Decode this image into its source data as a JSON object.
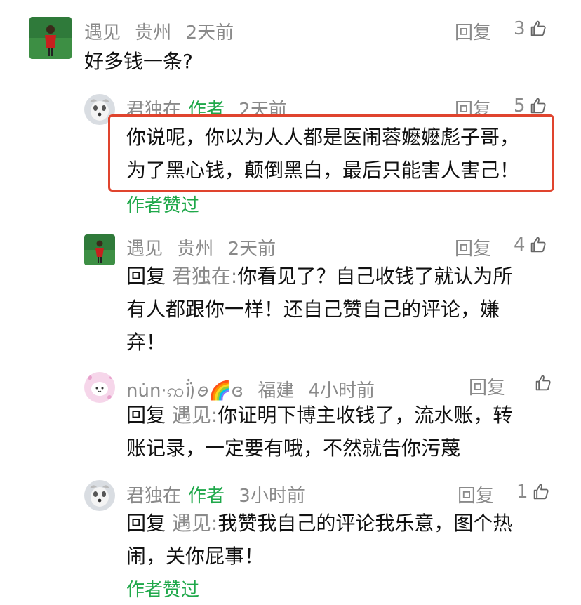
{
  "comments": [
    {
      "user": "遇见",
      "location": "贵州",
      "time": "2天前",
      "reply_label": "回复",
      "likes": "3",
      "text": "好多钱一条?"
    },
    {
      "user": "君独在",
      "author_tag": "作者",
      "time": "2天前",
      "reply_label": "回复",
      "likes": "5",
      "text_line1": "你说呢，你以为人人都是医闹蓉嬷嬷彪子哥，",
      "text_line2": "为了黑心钱，颠倒黑白，最后只能害人害己！",
      "liked_by": "作者赞过"
    },
    {
      "user": "遇见",
      "location": "贵州",
      "time": "2天前",
      "reply_label": "回复",
      "likes": "4",
      "reply_prefix": "回复",
      "reply_to": "君独在:",
      "text_line1": "你看见了？自己收钱了就认为所",
      "text_line2": "有人都跟你一样！还自己赞自己的评论，嫌",
      "text_line3": "弃！"
    },
    {
      "user": "nu̇n·ꩡ꩞ꪮ🌈ɞ",
      "location": "福建",
      "time": "4小时前",
      "reply_label": "回复",
      "likes": "",
      "reply_prefix": "回复",
      "reply_to": "遇见:",
      "text_line1": "你证明下博主收钱了，流水账，转",
      "text_line2": "账记录，一定要有哦，不然就告你污蔑"
    },
    {
      "user": "君独在",
      "author_tag": "作者",
      "time": "3小时前",
      "reply_label": "回复",
      "likes": "1",
      "reply_prefix": "回复",
      "reply_to": "遇见:",
      "text_line1": "我赞我自己的评论我乐意，图个热",
      "text_line2": "闹，关你屁事！",
      "liked_by": "作者赞过"
    }
  ],
  "colors": {
    "author": "#1fa84a",
    "meta": "#8a8a8a",
    "highlight": "#e0442e"
  }
}
